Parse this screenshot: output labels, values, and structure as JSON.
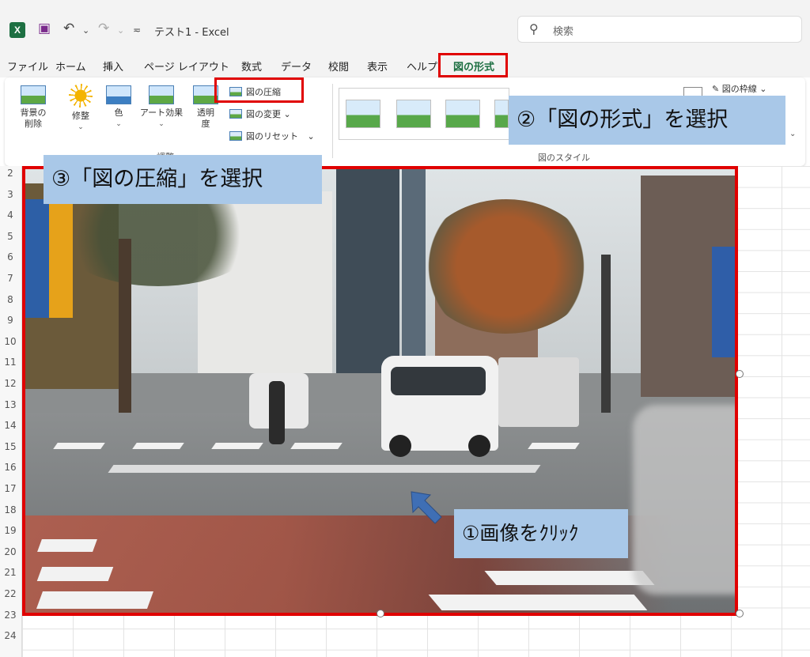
{
  "app": {
    "logo": "X",
    "doc_title": "テスト1  -  Excel"
  },
  "search": {
    "placeholder": "検索"
  },
  "tabs": [
    {
      "label": "ファイル"
    },
    {
      "label": "ホーム"
    },
    {
      "label": "挿入"
    },
    {
      "label": "ページ レイアウト"
    },
    {
      "label": "数式"
    },
    {
      "label": "データ"
    },
    {
      "label": "校閲"
    },
    {
      "label": "表示"
    },
    {
      "label": "ヘルプ"
    },
    {
      "label": "図の形式",
      "active": true
    }
  ],
  "ribbon": {
    "remove_bg": {
      "line1": "背景の",
      "line2": "削除"
    },
    "corrections": "修整",
    "color": "色",
    "artistic": "アート効果",
    "transparency": {
      "line1": "透明",
      "line2": "度"
    },
    "compress": "図の圧縮",
    "change": "図の変更",
    "reset": "図のリセット",
    "group_adjust": "調整",
    "group_styles": "図のスタイル",
    "border": "図の枠線"
  },
  "row_numbers": [
    "2",
    "3",
    "4",
    "5",
    "6",
    "7",
    "8",
    "9",
    "10",
    "11",
    "12",
    "13",
    "14",
    "15",
    "16",
    "17",
    "18",
    "19",
    "20",
    "21",
    "22",
    "23",
    "24"
  ],
  "callouts": {
    "step1": "①画像をｸﾘｯｸ",
    "step2": "②「図の形式」を選択",
    "step3": "③「図の圧縮」を選択"
  },
  "colors": {
    "highlight": "#e00000",
    "callout_bg": "#a9c8e8",
    "excel_green": "#1d6f42",
    "arrow": "#3f6fb5"
  }
}
